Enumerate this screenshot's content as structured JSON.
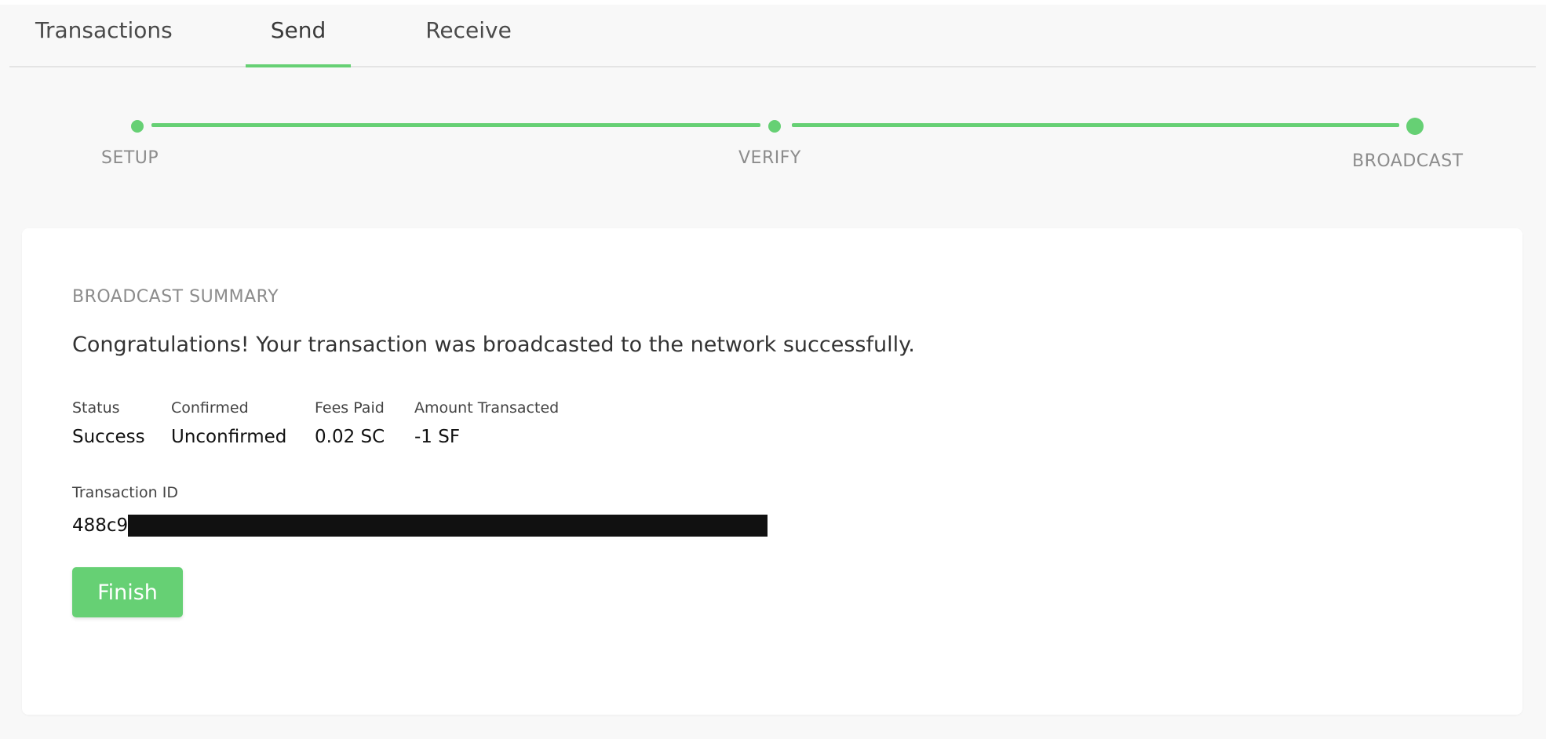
{
  "tabs": [
    {
      "label": "Transactions",
      "active": false
    },
    {
      "label": "Send",
      "active": true
    },
    {
      "label": "Receive",
      "active": false
    }
  ],
  "stepper": {
    "steps": [
      {
        "label": "SETUP",
        "complete": true
      },
      {
        "label": "VERIFY",
        "complete": true
      },
      {
        "label": "BROADCAST",
        "current": true
      }
    ]
  },
  "summary": {
    "title": "BROADCAST SUMMARY",
    "message": "Congratulations! Your transaction was broadcasted to the network successfully.",
    "stats": [
      {
        "label": "Status",
        "value": "Success"
      },
      {
        "label": "Confirmed",
        "value": "Unconfirmed"
      },
      {
        "label": "Fees Paid",
        "value": "0.02 SC"
      },
      {
        "label": "Amount Transacted",
        "value": "-1 SF"
      }
    ],
    "transaction_id_label": "Transaction ID",
    "transaction_id_visible_prefix": "488c9",
    "finish_label": "Finish"
  },
  "colors": {
    "accent": "#66d074",
    "background": "#f8f8f8",
    "card": "#ffffff",
    "muted_text": "#8c8c8c"
  }
}
